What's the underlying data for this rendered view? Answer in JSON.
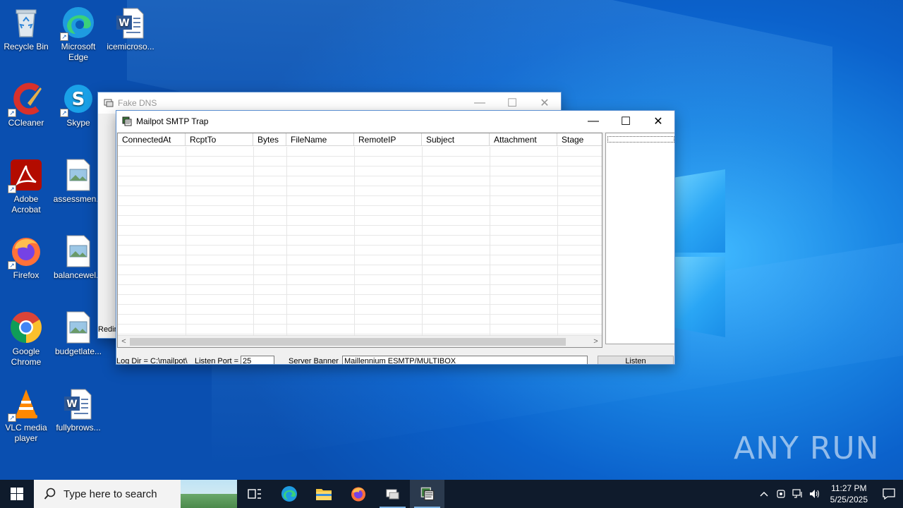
{
  "desktop": {
    "icons": [
      {
        "label": "Recycle Bin",
        "icon": "recycle-bin-icon"
      },
      {
        "label": "Microsoft Edge",
        "icon": "edge-icon"
      },
      {
        "label": "icemicroso...",
        "icon": "word-doc-icon"
      },
      {
        "label": "CCleaner",
        "icon": "ccleaner-icon"
      },
      {
        "label": "Skype",
        "icon": "skype-icon"
      },
      {
        "label": "Adobe Acrobat",
        "icon": "acrobat-icon"
      },
      {
        "label": "assessmen...",
        "icon": "image-file-icon"
      },
      {
        "label": "Firefox",
        "icon": "firefox-icon"
      },
      {
        "label": "balancewel...",
        "icon": "image-file-icon"
      },
      {
        "label": "Google Chrome",
        "icon": "chrome-icon"
      },
      {
        "label": "budgetlate...",
        "icon": "image-file-icon"
      },
      {
        "label": "VLC media player",
        "icon": "vlc-icon"
      },
      {
        "label": "fullybrows...",
        "icon": "word-doc-icon"
      }
    ]
  },
  "fake_dns": {
    "title": "Fake DNS",
    "side_text": "Redir"
  },
  "mailpot": {
    "title": "Mailpot SMTP Trap",
    "columns": [
      "ConnectedAt",
      "RcptTo",
      "Bytes",
      "FileName",
      "RemoteIP",
      "Subject",
      "Attachment",
      "Stage"
    ],
    "rows": [],
    "bottom": {
      "log_dir": "Log Dir = C:\\mailpot\\",
      "listen_port_label": "Listen Port =",
      "listen_port_value": "25",
      "banner_label": "Server Banner",
      "banner_value": "Maillennium ESMTP/MULTIBOX",
      "listen_button": "Listen"
    }
  },
  "taskbar": {
    "search_placeholder": "Type here to search",
    "time": "11:27 PM",
    "date": "5/25/2025"
  },
  "watermark": "ANY RUN"
}
